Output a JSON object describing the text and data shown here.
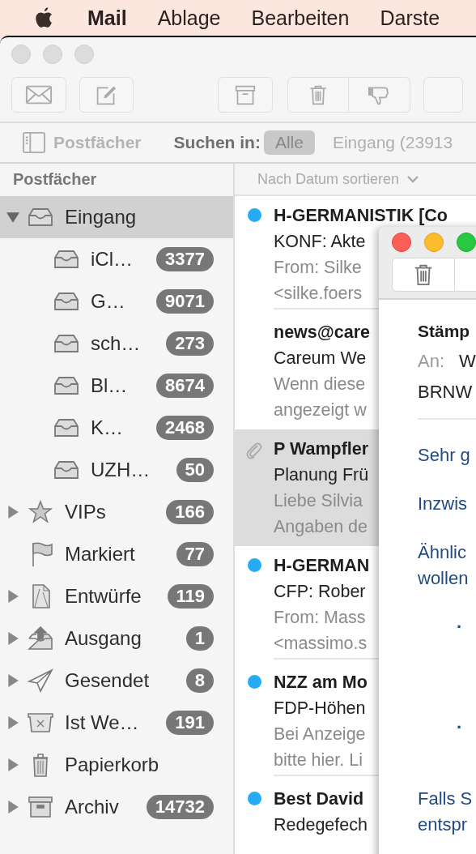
{
  "menu_bar": {
    "app_name": "Mail",
    "items": [
      "Ablage",
      "Bearbeiten",
      "Darste"
    ]
  },
  "favorites_bar": {
    "mailboxes_button": "Postfächer",
    "search_label": "Suchen in:",
    "scopes": [
      {
        "label": "Alle",
        "selected": true
      },
      {
        "label": "Eingang (23913",
        "selected": false
      }
    ]
  },
  "sidebar": {
    "heading": "Postfächer",
    "items": [
      {
        "label": "Eingang",
        "kind": "inbox",
        "expanded": true,
        "selected": true,
        "children": [
          {
            "label": "iCl…",
            "kind": "inbox",
            "count": "3377",
            "selected": false
          },
          {
            "label": "G…",
            "kind": "inbox",
            "count": "9071",
            "selected": false
          },
          {
            "label": "sch…",
            "kind": "inbox",
            "count": "273",
            "selected": false
          },
          {
            "label": "Bl…",
            "kind": "inbox",
            "count": "8674",
            "selected": false
          },
          {
            "label": "K…",
            "kind": "inbox",
            "count": "2468",
            "selected": false
          },
          {
            "label": "UZH…",
            "kind": "inbox",
            "count": "50",
            "selected": false
          }
        ]
      },
      {
        "label": "VIPs",
        "kind": "vip",
        "expanded": false,
        "count": "166",
        "selected": false
      },
      {
        "label": "Markiert",
        "kind": "flag",
        "count": "77",
        "selected": false
      },
      {
        "label": "Entwürfe",
        "kind": "drafts",
        "expanded": false,
        "count": "119",
        "selected": false
      },
      {
        "label": "Ausgang",
        "kind": "outbox",
        "expanded": false,
        "count": "1",
        "selected": false
      },
      {
        "label": "Gesendet",
        "kind": "sent",
        "expanded": false,
        "count": "8",
        "selected": false
      },
      {
        "label": "Ist We…",
        "kind": "junk",
        "expanded": false,
        "count": "191",
        "selected": false
      },
      {
        "label": "Papierkorb",
        "kind": "trash",
        "expanded": false,
        "selected": false
      },
      {
        "label": "Archiv",
        "kind": "archive",
        "expanded": false,
        "count": "14732",
        "selected": false
      }
    ]
  },
  "message_list": {
    "sort_label": "Nach Datum sortieren",
    "messages": [
      {
        "sender": "H-GERMANISTIK [Co",
        "subject": "KONF: Akte",
        "preview_lines": [
          "From: Silke",
          "<silke.foers"
        ],
        "unread": true,
        "attachment": false,
        "selected": false
      },
      {
        "sender": "news@care",
        "subject": "Careum We",
        "preview_lines": [
          "Wenn diese",
          "angezeigt w"
        ],
        "unread": false,
        "attachment": false,
        "selected": false
      },
      {
        "sender": "P Wampfler",
        "subject": "Planung Frü",
        "preview_lines": [
          "Liebe Silvia",
          "Angaben de"
        ],
        "unread": false,
        "attachment": true,
        "selected": true
      },
      {
        "sender": "H-GERMAN",
        "subject": "CFP: Rober",
        "preview_lines": [
          "From: Mass",
          "<massimo.s"
        ],
        "unread": true,
        "attachment": false,
        "selected": false
      },
      {
        "sender": "NZZ am Mo",
        "subject": "FDP-Höhen",
        "preview_lines": [
          "Bei Anzeige",
          "bitte hier. Li"
        ],
        "unread": true,
        "attachment": false,
        "selected": false
      },
      {
        "sender": "Best David",
        "subject": "Redegefech",
        "unread": true,
        "attachment": false,
        "selected": false
      }
    ]
  },
  "message_viewer": {
    "subject": "Stämp",
    "to_label": "An:",
    "to_value": "W",
    "to_line2": "BRNW",
    "body": [
      {
        "kind": "paragraph",
        "lines": [
          "Sehr g"
        ]
      },
      {
        "kind": "paragraph",
        "lines": [
          "Inzwis"
        ]
      },
      {
        "kind": "paragraph",
        "lines": [
          "Ähnlic",
          "wollen"
        ]
      },
      {
        "kind": "bullet",
        "marker": "·"
      },
      {
        "kind": "bullet",
        "marker": "·"
      },
      {
        "kind": "paragraph",
        "lines": [
          "Falls S",
          "entspr"
        ]
      }
    ]
  }
}
